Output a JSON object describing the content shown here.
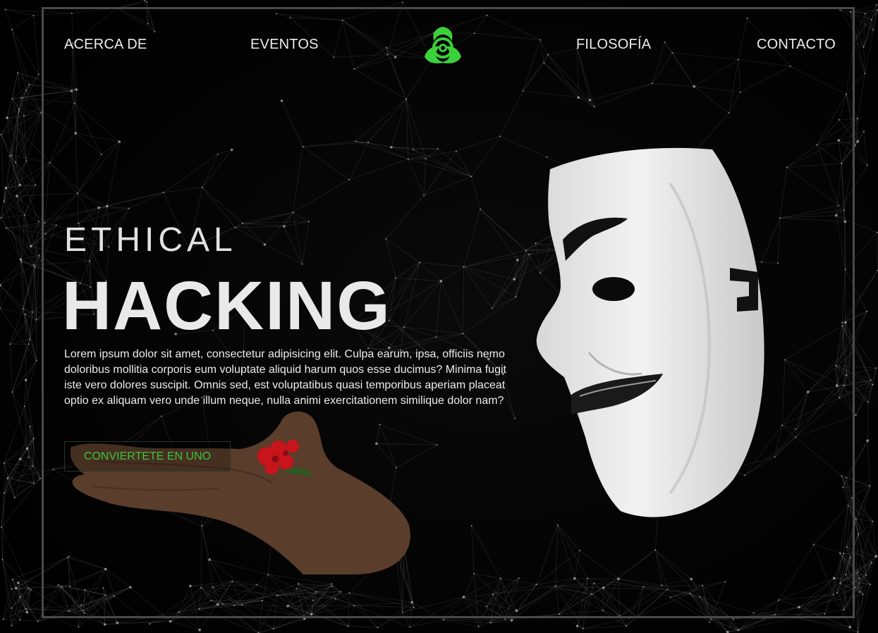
{
  "colors": {
    "background": "#030303",
    "accent": "#3bd13b",
    "frame": "#4a4a4a",
    "text": "#ececec"
  },
  "nav": {
    "links": [
      "ACERCA DE",
      "EVENTOS",
      "FILOSOFÍA",
      "CONTACTO"
    ],
    "logo_icon": "biohazard-icon"
  },
  "hero": {
    "title_line1": "ETHICAL",
    "title_line2": "HACKING",
    "description": "Lorem ipsum dolor sit amet, consectetur adipisicing elit. Culpa earum, ipsa, officiis nemo doloribus mollitia corporis eum voluptate aliquid harum quos esse ducimus? Minima fugit iste vero dolores suscipit. Omnis sed, est voluptatibus quasi temporibus aperiam placeat optio ex aliquam vero unde illum neque, nulla animi exercitationem similique dolor nam?",
    "cta_label": "CONVIERTETE EN UNO"
  }
}
